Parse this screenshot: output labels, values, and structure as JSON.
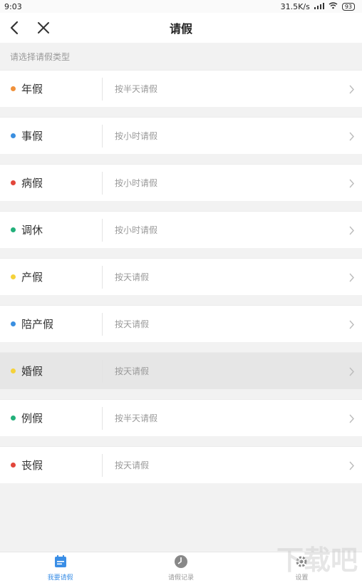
{
  "status_bar": {
    "time": "9:03",
    "speed": "31.5K/s",
    "battery": "93"
  },
  "header": {
    "title": "请假"
  },
  "section": {
    "label": "请选择请假类型"
  },
  "leave_types": [
    {
      "name": "年假",
      "desc": "按半天请假",
      "color": "#f0913a"
    },
    {
      "name": "事假",
      "desc": "按小时请假",
      "color": "#3b8fe0"
    },
    {
      "name": "病假",
      "desc": "按小时请假",
      "color": "#e2463a"
    },
    {
      "name": "调休",
      "desc": "按小时请假",
      "color": "#22b07a"
    },
    {
      "name": "产假",
      "desc": "按天请假",
      "color": "#f5d23a"
    },
    {
      "name": "陪产假",
      "desc": "按天请假",
      "color": "#3b8fe0"
    },
    {
      "name": "婚假",
      "desc": "按天请假",
      "color": "#f5d23a"
    },
    {
      "name": "例假",
      "desc": "按半天请假",
      "color": "#22b07a"
    },
    {
      "name": "丧假",
      "desc": "按天请假",
      "color": "#e2463a"
    }
  ],
  "tabs": [
    {
      "label": "我要请假",
      "icon": "calendar-icon"
    },
    {
      "label": "请假记录",
      "icon": "clock-icon"
    },
    {
      "label": "设置",
      "icon": "gear-icon"
    }
  ],
  "watermark": "下载吧"
}
